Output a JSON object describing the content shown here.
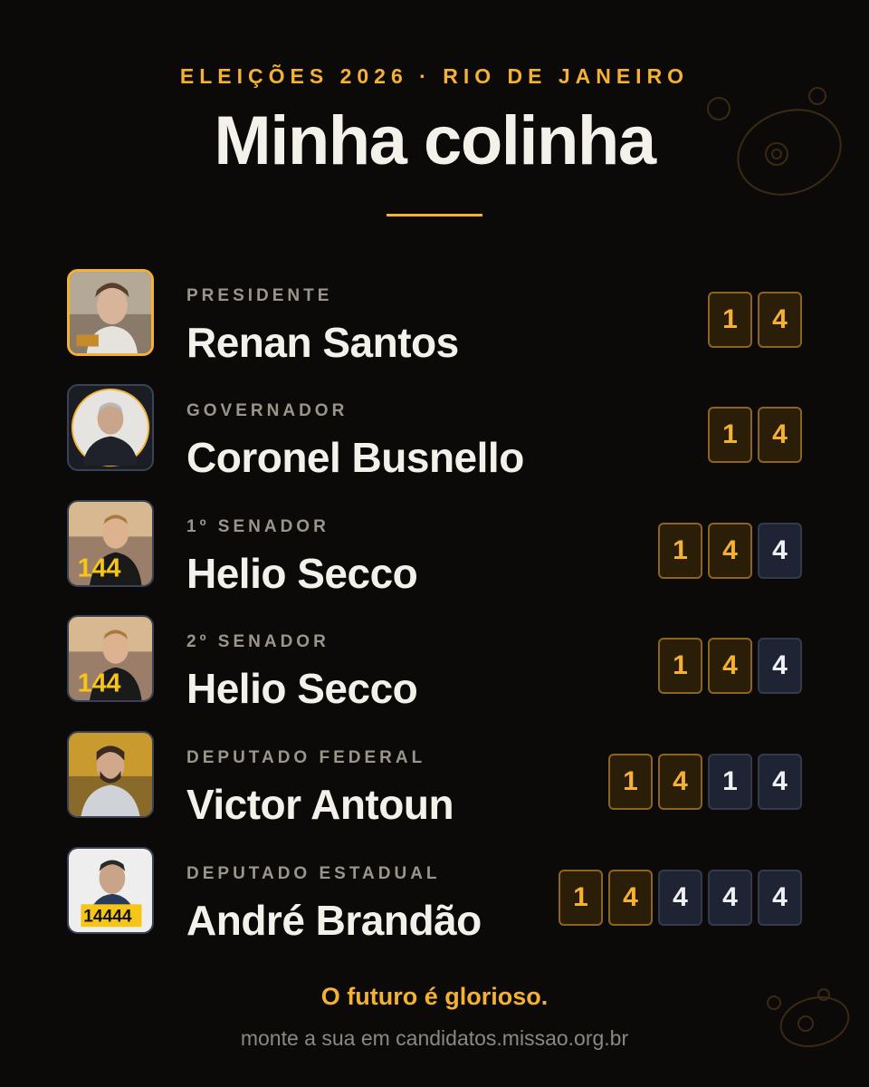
{
  "header": {
    "kicker": "ELEIÇÕES 2026 · RIO DE JANEIRO",
    "title": "Minha colinha"
  },
  "colors": {
    "background": "#0c0a09",
    "accent": "#f5b133",
    "text": "#f4f1ea",
    "muted": "#9b958c",
    "party_digit_bg": "#2a1e08",
    "candidate_digit_bg": "#1e2433"
  },
  "candidates": [
    {
      "office": "PRESIDENTE",
      "name": "Renan Santos",
      "digits": [
        "1",
        "4"
      ],
      "party_digits": 2,
      "photo_text": ""
    },
    {
      "office": "GOVERNADOR",
      "name": "Coronel Busnello",
      "digits": [
        "1",
        "4"
      ],
      "party_digits": 2,
      "photo_text": ""
    },
    {
      "office": "1º SENADOR",
      "name": "Helio Secco",
      "digits": [
        "1",
        "4",
        "4"
      ],
      "party_digits": 2,
      "photo_text": "144"
    },
    {
      "office": "2º SENADOR",
      "name": "Helio Secco",
      "digits": [
        "1",
        "4",
        "4"
      ],
      "party_digits": 2,
      "photo_text": "144"
    },
    {
      "office": "DEPUTADO FEDERAL",
      "name": "Victor Antoun",
      "digits": [
        "1",
        "4",
        "1",
        "4"
      ],
      "party_digits": 2,
      "photo_text": ""
    },
    {
      "office": "DEPUTADO ESTADUAL",
      "name": "André Brandão",
      "digits": [
        "1",
        "4",
        "4",
        "4",
        "4"
      ],
      "party_digits": 2,
      "photo_text": "14444"
    }
  ],
  "footer": {
    "slogan": "O futuro é glorioso.",
    "cta": "monte a sua em candidatos.missao.org.br"
  }
}
